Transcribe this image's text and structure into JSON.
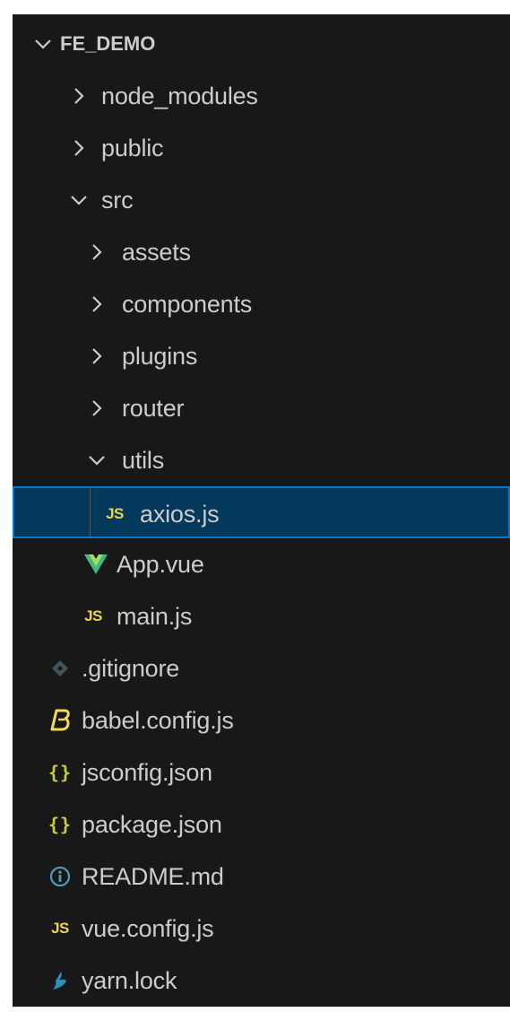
{
  "explorer": {
    "root": {
      "label": "FE_DEMO",
      "expanded": true
    },
    "items": [
      {
        "label": "node_modules",
        "kind": "folder",
        "expanded": false
      },
      {
        "label": "public",
        "kind": "folder",
        "expanded": false
      },
      {
        "label": "src",
        "kind": "folder",
        "expanded": true
      },
      {
        "label": "assets",
        "kind": "folder",
        "expanded": false
      },
      {
        "label": "components",
        "kind": "folder",
        "expanded": false
      },
      {
        "label": "plugins",
        "kind": "folder",
        "expanded": false
      },
      {
        "label": "router",
        "kind": "folder",
        "expanded": false
      },
      {
        "label": "utils",
        "kind": "folder",
        "expanded": true
      },
      {
        "label": "axios.js",
        "kind": "file",
        "icon": "javascript-icon",
        "icon_text": "JS",
        "selected": true
      },
      {
        "label": "App.vue",
        "kind": "file",
        "icon": "vue-icon"
      },
      {
        "label": "main.js",
        "kind": "file",
        "icon": "javascript-icon",
        "icon_text": "JS"
      },
      {
        "label": ".gitignore",
        "kind": "file",
        "icon": "git-icon"
      },
      {
        "label": "babel.config.js",
        "kind": "file",
        "icon": "babel-icon"
      },
      {
        "label": "jsconfig.json",
        "kind": "file",
        "icon": "json-icon",
        "icon_text": "{}"
      },
      {
        "label": "package.json",
        "kind": "file",
        "icon": "json-icon",
        "icon_text": "{}"
      },
      {
        "label": "README.md",
        "kind": "file",
        "icon": "info-icon"
      },
      {
        "label": "vue.config.js",
        "kind": "file",
        "icon": "javascript-icon",
        "icon_text": "JS"
      },
      {
        "label": "yarn.lock",
        "kind": "file",
        "icon": "yarn-icon"
      }
    ]
  },
  "colors": {
    "panel_background": "#181818",
    "text": "#cccccc",
    "selection_background": "#04395e",
    "selection_border": "#0078d4",
    "javascript_icon": "#e8d44d",
    "json_icon": "#cbcb41",
    "vue_icon_primary": "#41b883",
    "vue_icon_secondary": "#a5dc5a",
    "babel_icon": "#f5da55",
    "info_icon": "#519aba",
    "git_icon": "#41535b",
    "yarn_icon": "#2c8ebb",
    "indent_guide": "#585858"
  }
}
